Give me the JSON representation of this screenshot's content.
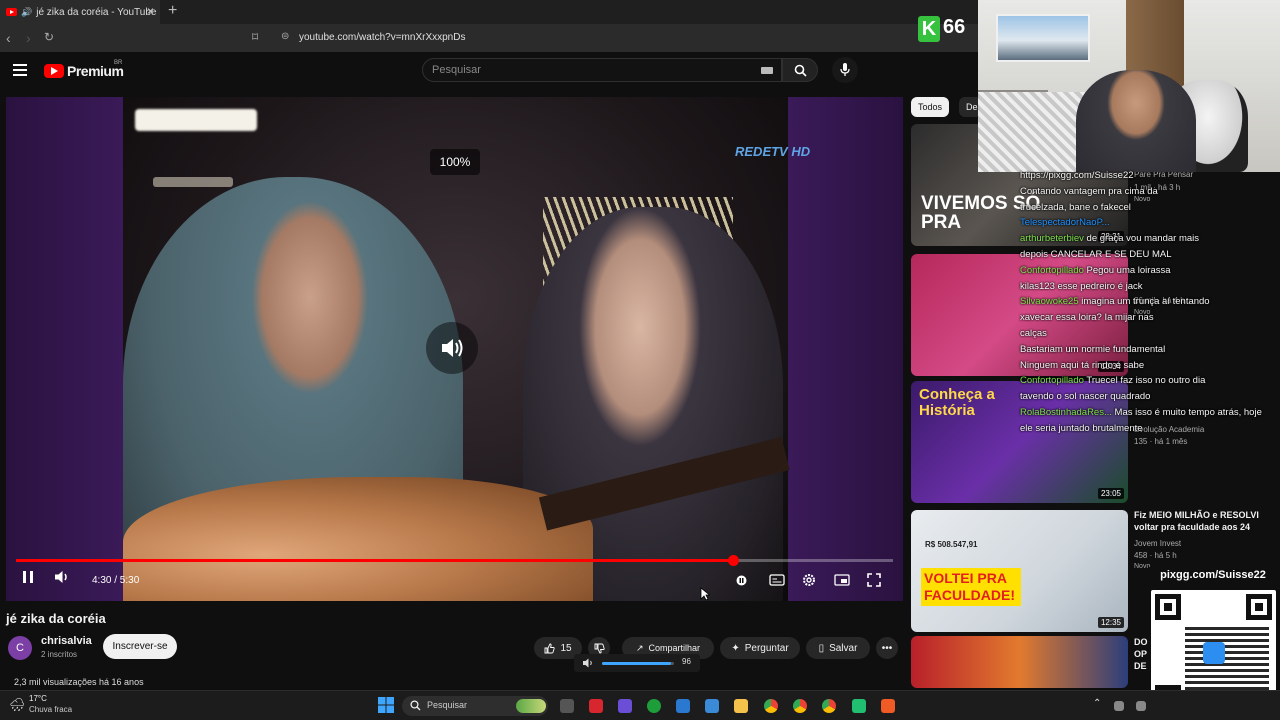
{
  "browser": {
    "tab_title": "jé zika da coréia - YouTube",
    "url": "youtube.com/watch?v=mnXrXxxpnDs"
  },
  "header": {
    "brand": "Premium",
    "country": "BR",
    "search_placeholder": "Pesquisar"
  },
  "player": {
    "overlay_percent": "100%",
    "channel_logo": "REDETV HD",
    "time": "4:30 / 5:30",
    "progress_fraction": 0.818
  },
  "video": {
    "title": "jé zika da coréia",
    "channel": "chrisalvia",
    "channel_initial": "C",
    "subscribers": "2 inscritos",
    "subscribe_label": "Inscrever-se",
    "likes": "15",
    "share_label": "Compartilhar",
    "ask_label": "Perguntar",
    "save_label": "Salvar",
    "volume_value": "96",
    "stats": "2,3 mil visualizações  há 16 anos"
  },
  "sidebar": {
    "chips": [
      "Todos",
      "De"
    ],
    "recs": [
      {
        "thumb_text": "VIVEMOS SÓ PRA",
        "duration": "28:31",
        "channel": "Pare Pra Pensar",
        "meta": "1 mil · há 3 h",
        "badge": "Novo"
      },
      {
        "duration": "10:34",
        "meta": "26 mil · há 4 h",
        "badge": "Novo"
      },
      {
        "thumb_text": "Conheça a História",
        "duration": "23:05",
        "channel": "Evolução Academia",
        "meta": "135 · há 1 mês"
      },
      {
        "thumb_text": "VOLTEI PRA FACULDADE!",
        "duration": "12:35",
        "title": "Fiz MEIO MILHÃO e RESOLVI voltar pra faculdade aos 24",
        "channel": "Jovem Invest",
        "meta": "458 · há 5 h",
        "badge": "Novo",
        "amount": "R$ 508.547,91"
      },
      {
        "title": "DO OP DE"
      }
    ]
  },
  "stream": {
    "viewer_count": "66",
    "qr_title": "pixgg.com/Suisse22",
    "chat": [
      {
        "user": "",
        "text": "https://pixgg.com/Suisse22",
        "cls": "u3"
      },
      {
        "user": "",
        "text": "Contando vantagem pra cima da",
        "cls": "u3"
      },
      {
        "user": "",
        "text": "trucelzada, bane o fakecel",
        "cls": "u3"
      },
      {
        "user": "TelespectadorNaoP...",
        "text": "",
        "cls": "u1"
      },
      {
        "user": "arthurbeterbiev",
        "text": "de graça vou mandar mais",
        "cls": "u2"
      },
      {
        "user": "",
        "text": "depois CANCELAR E SE DEU MAL",
        "cls": "u3"
      },
      {
        "user": "Confortopillado",
        "text": "Pegou uma loirassa",
        "cls": "u2"
      },
      {
        "user": "kilas123",
        "text": "esse pedreiro é jack",
        "cls": "u3"
      },
      {
        "user": "Silvaowoke25",
        "text": "imagina um trunça aí tentando",
        "cls": "u2"
      },
      {
        "user": "",
        "text": "xavecar essa loira? Ia mijar nas",
        "cls": "u3"
      },
      {
        "user": "",
        "text": "calças",
        "cls": "u3"
      },
      {
        "user": "",
        "text": "Bastariam um normie fundamental",
        "cls": "u3"
      },
      {
        "user": "",
        "text": "Ninguem aqui tá rindo é sabe",
        "cls": "u3"
      },
      {
        "user": "Confortopillado",
        "text": "Truecel faz isso no outro dia",
        "cls": "u2"
      },
      {
        "user": "",
        "text": "tavendo o sol nascer quadrado",
        "cls": "u3"
      },
      {
        "user": "RolaBostinhadaRes...",
        "text": "Mas isso é muito tempo atrás, hoje",
        "cls": "u2"
      },
      {
        "user": "",
        "text": "ele seria juntado brutalmente",
        "cls": "u3"
      }
    ]
  },
  "taskbar": {
    "temperature": "17°C",
    "weather": "Chuva fraca",
    "search_label": "Pesquisar"
  },
  "colors": {
    "accent": "#ff0000",
    "volume": "#3ea6ff",
    "chat_green": "#7fe04c",
    "chat_blue": "#1e90ff"
  }
}
